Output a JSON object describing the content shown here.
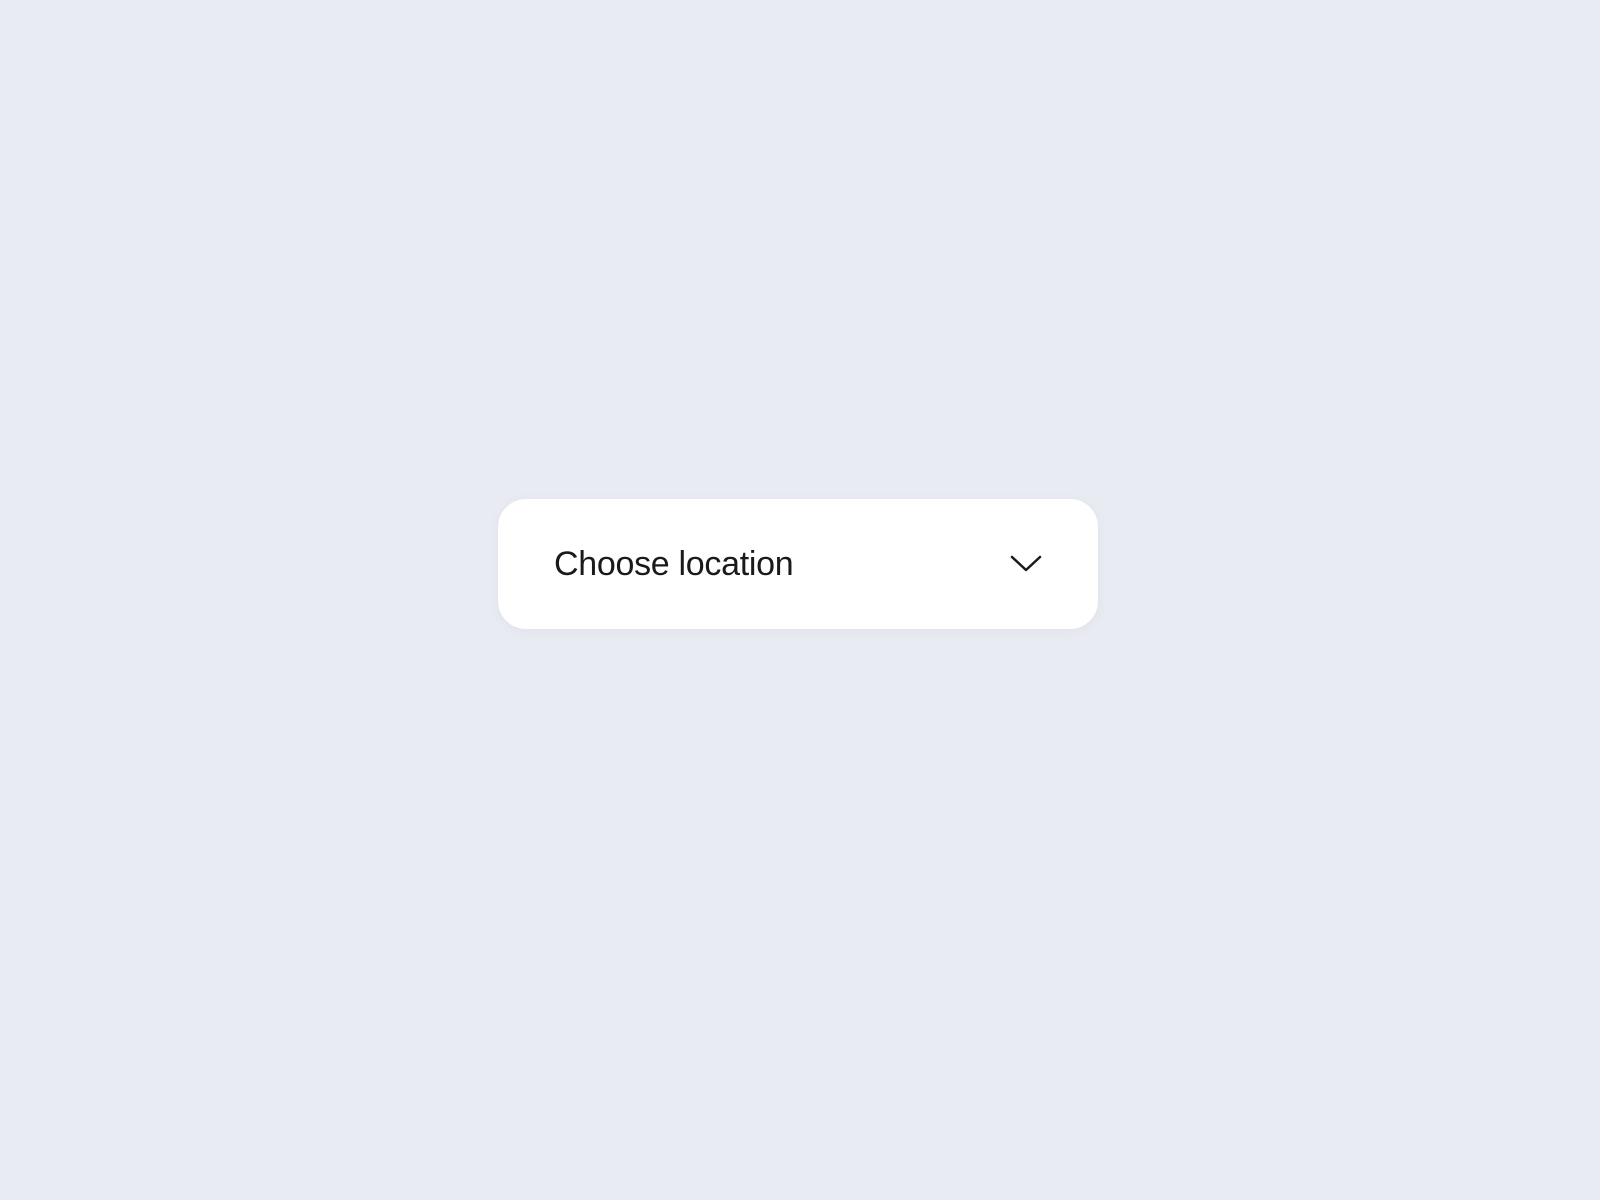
{
  "dropdown": {
    "label": "Choose location"
  }
}
